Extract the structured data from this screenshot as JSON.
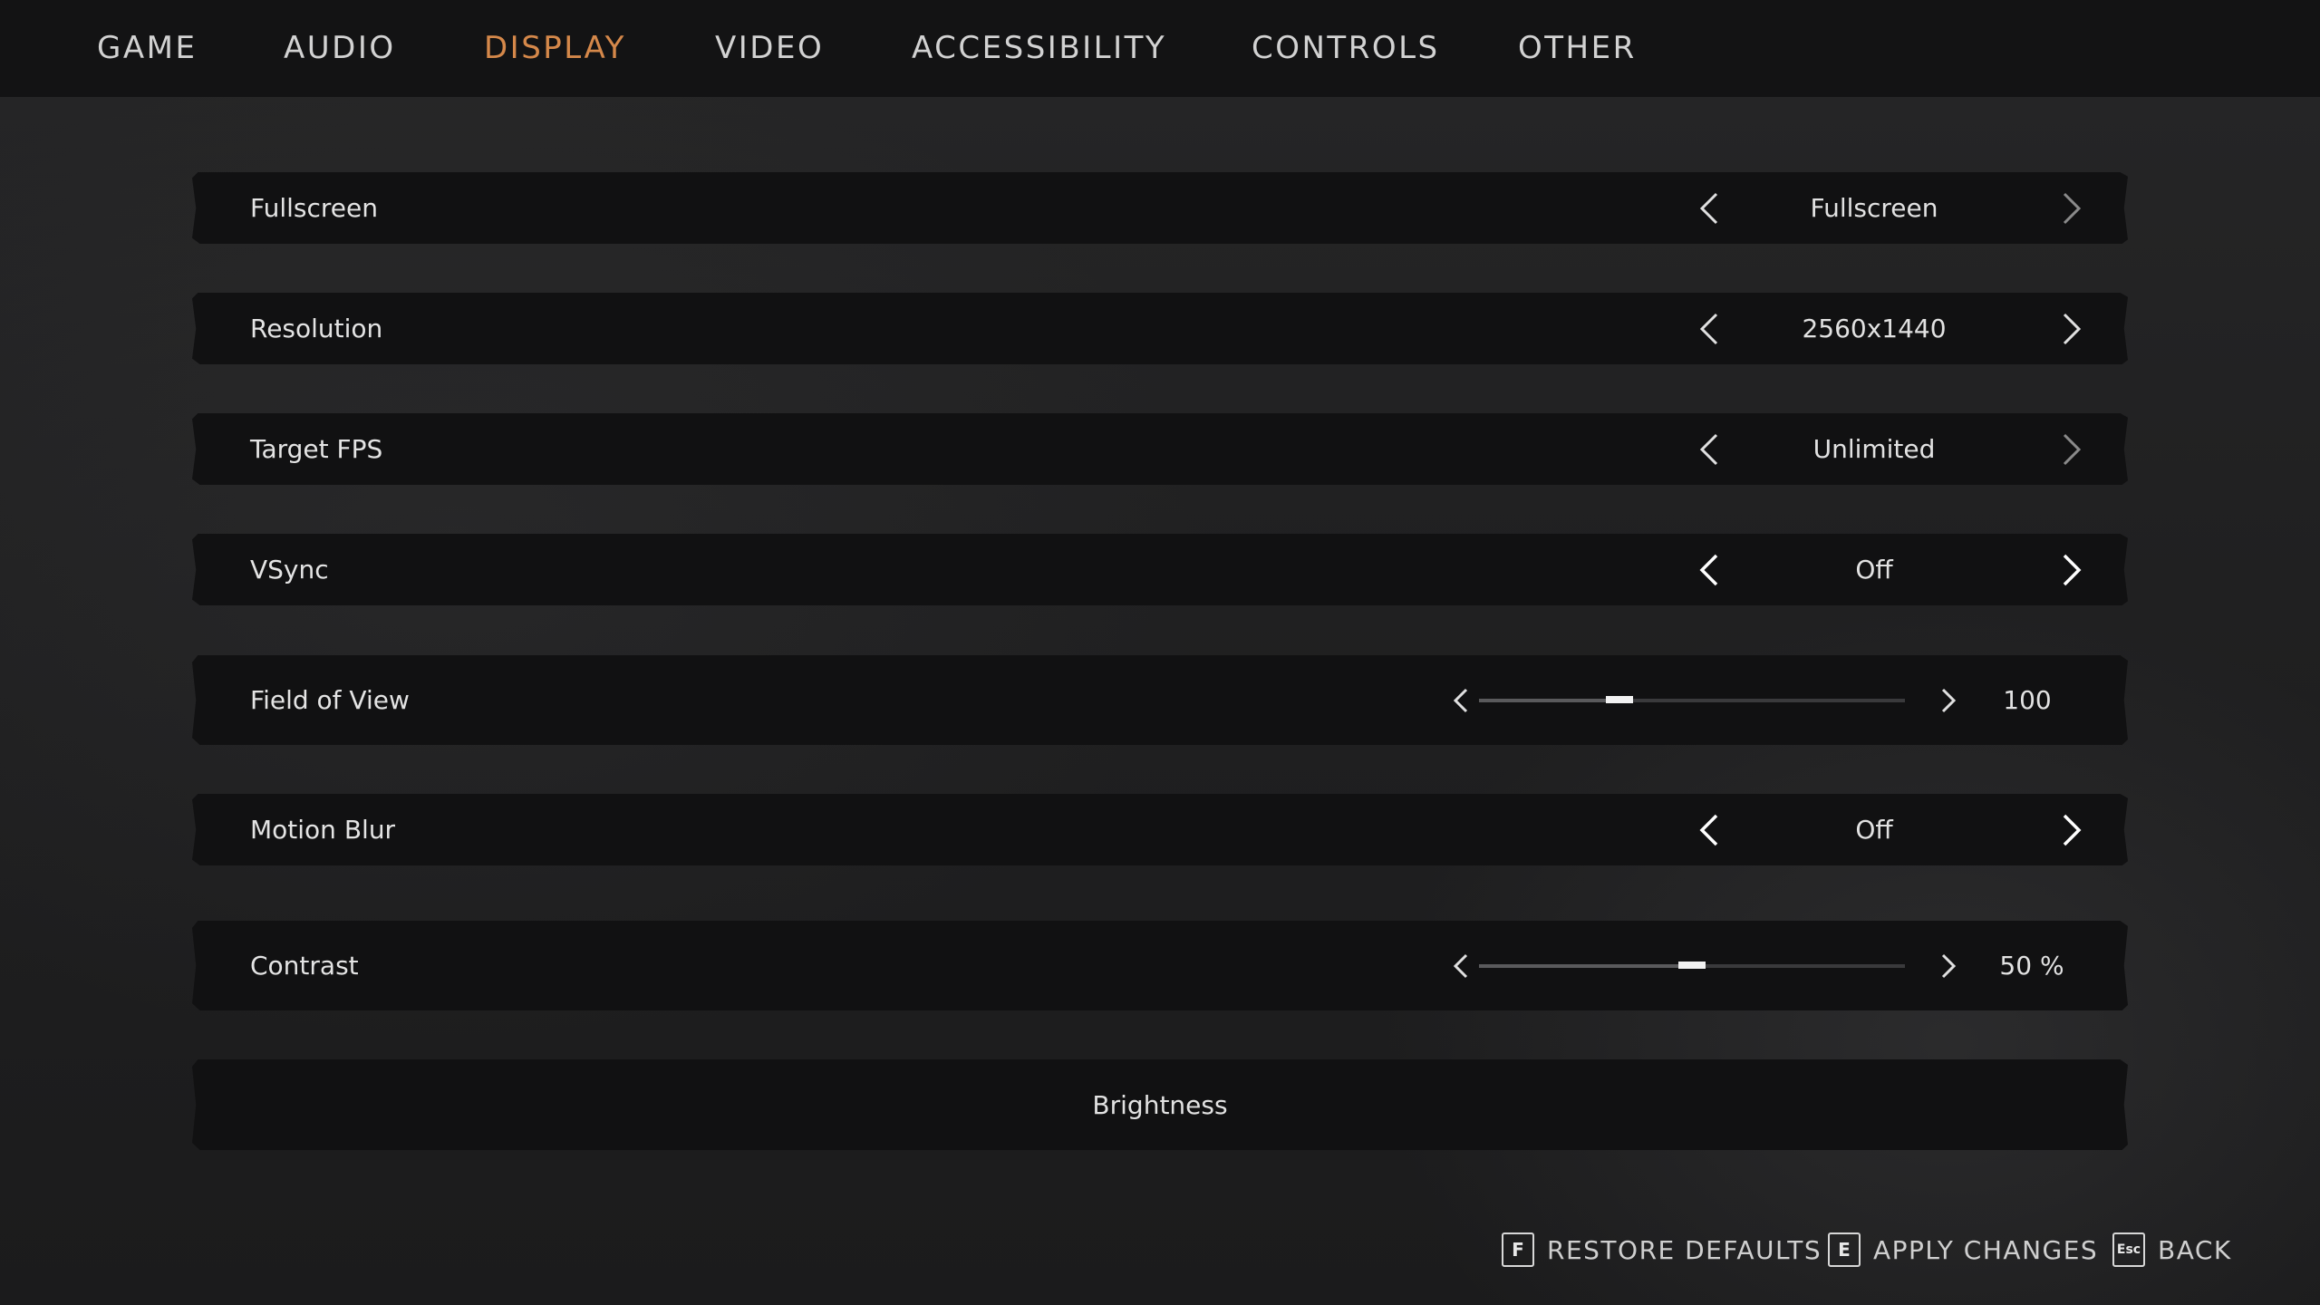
{
  "tabs": [
    {
      "label": "GAME",
      "active": false
    },
    {
      "label": "AUDIO",
      "active": false
    },
    {
      "label": "DISPLAY",
      "active": true
    },
    {
      "label": "VIDEO",
      "active": false
    },
    {
      "label": "ACCESSIBILITY",
      "active": false
    },
    {
      "label": "CONTROLS",
      "active": false
    },
    {
      "label": "OTHER",
      "active": false
    }
  ],
  "colors": {
    "accent": "#d5884a",
    "row_background": "#111112",
    "topbar_background": "#131314"
  },
  "settings": {
    "fullscreen": {
      "label": "Fullscreen",
      "value": "Fullscreen"
    },
    "resolution": {
      "label": "Resolution",
      "value": "2560x1440"
    },
    "target_fps": {
      "label": "Target FPS",
      "value": "Unlimited"
    },
    "vsync": {
      "label": "VSync",
      "value": "Off"
    },
    "field_of_view": {
      "label": "Field of View",
      "value": "100",
      "slider_level": 0.33
    },
    "motion_blur": {
      "label": "Motion Blur",
      "value": "Off"
    },
    "contrast": {
      "label": "Contrast",
      "value": "50 %",
      "slider_level": 0.5
    },
    "brightness": {
      "label": "Brightness"
    }
  },
  "icons": {
    "prev": "chevron-left-icon",
    "next": "chevron-right-icon"
  },
  "footer": {
    "restore": {
      "key": "F",
      "label": "RESTORE DEFAULTS"
    },
    "apply": {
      "key": "E",
      "label": "APPLY CHANGES"
    },
    "back": {
      "key": "Esc",
      "label": "BACK"
    }
  }
}
